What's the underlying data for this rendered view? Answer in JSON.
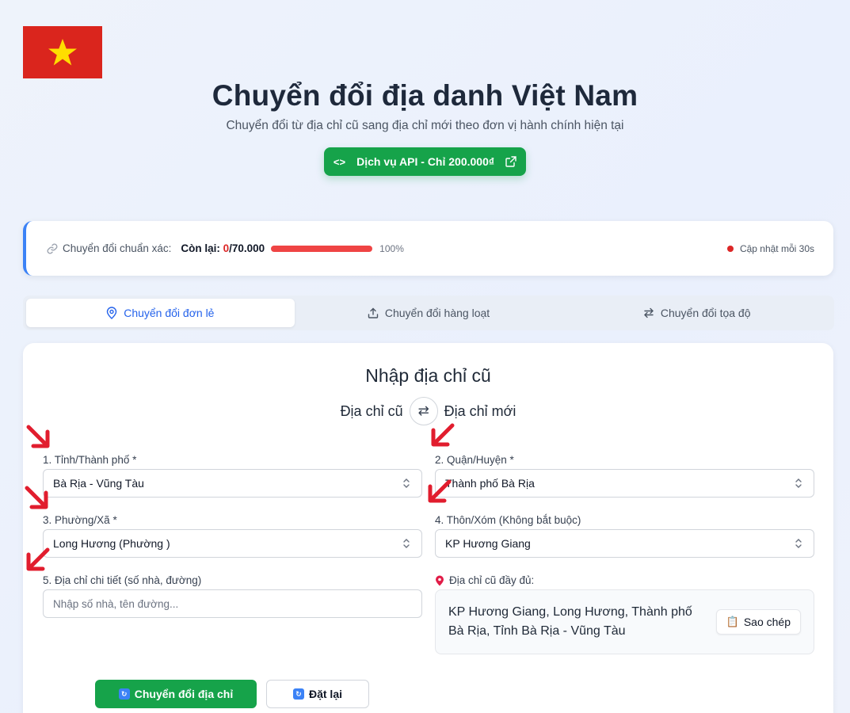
{
  "header": {
    "title": "Chuyển đổi địa danh Việt Nam",
    "subtitle": "Chuyển đổi từ địa chỉ cũ sang địa chỉ mới theo đơn vị hành chính hiện tại",
    "api_button_label": "Dịch vụ API - Chỉ 200.000₫"
  },
  "status": {
    "label": "Chuyển đổi chuẩn xác:",
    "remaining_label": "Còn lại:",
    "used": "0",
    "total": "/70.000",
    "percent_text": "100%",
    "progress_fraction": 1.0,
    "update_text": "Cập nhật mỗi 30s"
  },
  "tabs": [
    {
      "label": "Chuyển đổi đơn lẻ",
      "active": true
    },
    {
      "label": "Chuyển đổi hàng loạt",
      "active": false
    },
    {
      "label": "Chuyển đổi tọa độ",
      "active": false
    }
  ],
  "form": {
    "title": "Nhập địa chỉ cũ",
    "swap_left": "Địa chỉ cũ",
    "swap_right": "Địa chỉ mới",
    "province_label": "1. Tỉnh/Thành phố *",
    "province_value": "Bà Rịa - Vũng Tàu",
    "district_label": "2. Quận/Huyện *",
    "district_value": "Thành phố Bà Rịa",
    "ward_label": "3. Phường/Xã *",
    "ward_value": "Long Hương (Phường )",
    "hamlet_label": "4. Thôn/Xóm (Không bắt buộc)",
    "hamlet_value": "KP Hương Giang",
    "detail_label": "5. Địa chỉ chi tiết (số nhà, đường)",
    "detail_placeholder": "Nhập số nhà, tên đường...",
    "full_label": "Địa chỉ cũ đầy đủ:",
    "full_value": "KP Hương Giang, Long Hương, Thành phố Bà Rịa, Tỉnh Bà Rịa - Vũng Tàu",
    "copy_label": "Sao chép",
    "convert_label": "Chuyển đổi địa chỉ",
    "reset_label": "Đặt lại"
  },
  "colors": {
    "flag_red": "#da251d",
    "flag_star": "#ffde00",
    "accent_green": "#16a34a",
    "accent_blue": "#2563eb",
    "progress_red": "#ef4444",
    "annotation_arrow": "#e11d2e"
  }
}
